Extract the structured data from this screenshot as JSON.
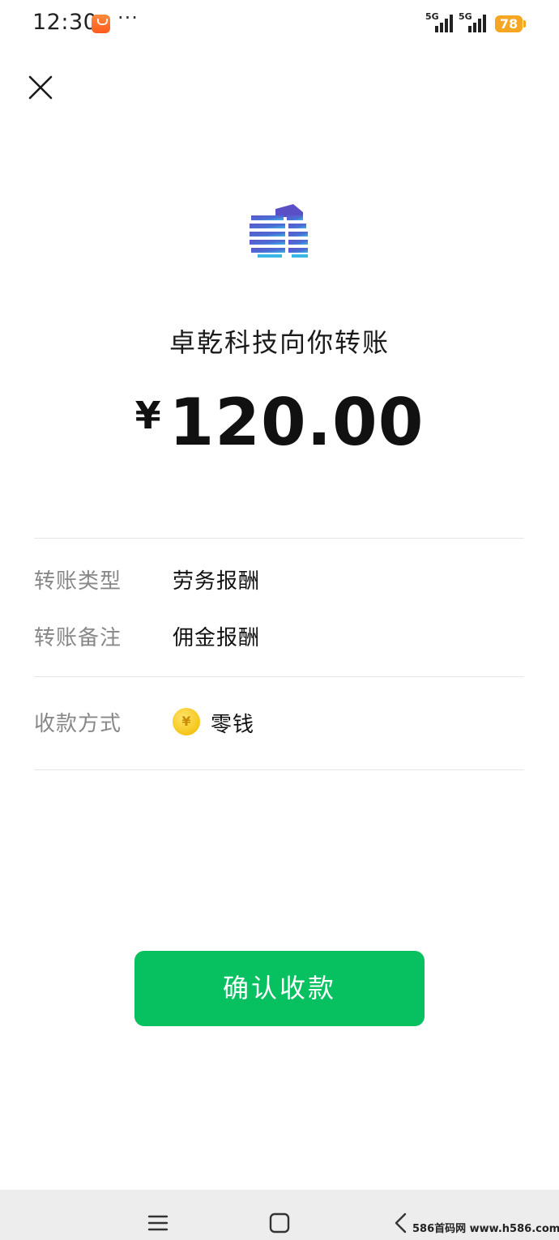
{
  "status_bar": {
    "time": "12:30",
    "more": "···",
    "signal_1": "5G",
    "signal_2": "5G",
    "battery": "78"
  },
  "icons": {
    "close": "close-icon",
    "logo": "building-logo",
    "coin": "coin-icon",
    "menu": "menu-icon",
    "home": "home-icon",
    "back": "back-icon"
  },
  "transfer": {
    "title": "卓乾科技向你转账",
    "currency": "¥",
    "amount": "120.00"
  },
  "details": {
    "type_label": "转账类型",
    "type_value": "劳务报酬",
    "note_label": "转账备注",
    "note_value": "佣金报酬",
    "method_label": "收款方式",
    "method_value": "零钱",
    "coin_symbol": "¥"
  },
  "actions": {
    "confirm_label": "确认收款"
  },
  "watermark": "586首码网 www.h586.com",
  "colors": {
    "accent": "#07c160",
    "battery": "#f5a623",
    "navbar": "#ededed"
  }
}
